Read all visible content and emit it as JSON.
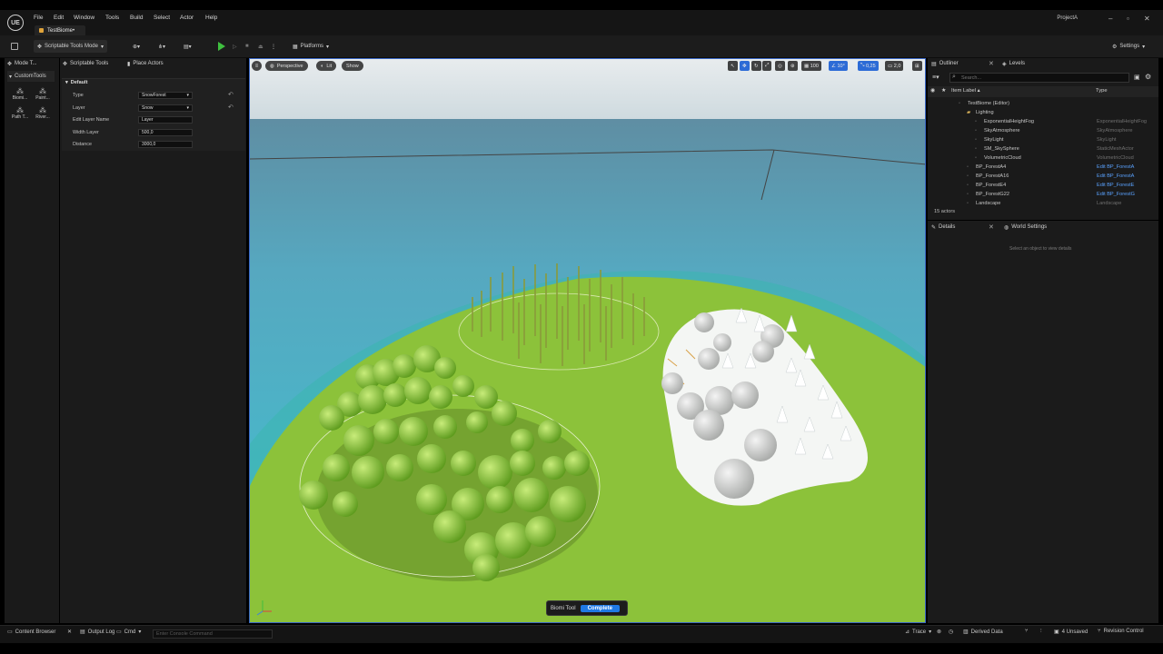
{
  "app": {
    "logo_text": "UE",
    "project": "ProjectA",
    "document_tab": "TestBiome•"
  },
  "menu": [
    "File",
    "Edit",
    "Window",
    "Tools",
    "Build",
    "Select",
    "Actor",
    "Help"
  ],
  "toolbar": {
    "mode": "Scriptable Tools Mode",
    "platforms": "Platforms",
    "settings": "Settings"
  },
  "left_tabs": {
    "mode_tab": "Mode T...",
    "scriptable_tools": "Scriptable Tools",
    "place_actors": "Place Actors"
  },
  "custom_tools": {
    "header": "CustomTools",
    "tools": [
      "Biomi...",
      "Paint...",
      "Path T...",
      "River..."
    ]
  },
  "details": {
    "section": "Default",
    "props": [
      {
        "label": "Type",
        "value": "SnowForest",
        "dropdown": true
      },
      {
        "label": "Layer",
        "value": "Snow",
        "dropdown": true
      },
      {
        "label": "Edit Layer Name",
        "value": "Layer",
        "dropdown": false
      },
      {
        "label": "Width Layer",
        "value": "500,0",
        "dropdown": false
      },
      {
        "label": "Distance",
        "value": "3000,0",
        "dropdown": false
      }
    ]
  },
  "viewport": {
    "perspective": "Perspective",
    "lit": "Lit",
    "show": "Show",
    "grid_snap": "100",
    "rot_snap": "10°",
    "scale_snap": "0,25",
    "cam_speed": "2,0",
    "biome_tool_label": "Biomi Tool",
    "complete_button": "Complete"
  },
  "outliner": {
    "tab": "Outliner",
    "levels_tab": "Levels",
    "search_placeholder": "Search...",
    "col_label": "Item Label ▴",
    "col_type": "Type",
    "rows": [
      {
        "name": "TestBiome (Editor)",
        "type": "",
        "indent": 0,
        "link": false
      },
      {
        "name": "Lighting",
        "type": "",
        "indent": 1,
        "link": false
      },
      {
        "name": "ExponentialHeightFog",
        "type": "ExponentialHeightFog",
        "indent": 2,
        "link": false
      },
      {
        "name": "SkyAtmosphere",
        "type": "SkyAtmosphere",
        "indent": 2,
        "link": false
      },
      {
        "name": "SkyLight",
        "type": "SkyLight",
        "indent": 2,
        "link": false
      },
      {
        "name": "SM_SkySphere",
        "type": "StaticMeshActor",
        "indent": 2,
        "link": false
      },
      {
        "name": "VolumetricCloud",
        "type": "VolumetricCloud",
        "indent": 2,
        "link": false
      },
      {
        "name": "BP_ForestA4",
        "type": "Edit BP_ForestA",
        "indent": 1,
        "link": true
      },
      {
        "name": "BP_ForestA16",
        "type": "Edit BP_ForestA",
        "indent": 1,
        "link": true
      },
      {
        "name": "BP_ForestE4",
        "type": "Edit BP_ForestE",
        "indent": 1,
        "link": true
      },
      {
        "name": "BP_ForestG22",
        "type": "Edit BP_ForestG",
        "indent": 1,
        "link": true
      },
      {
        "name": "Landscape",
        "type": "Landscape",
        "indent": 1,
        "link": false
      }
    ],
    "actor_count": "15 actors"
  },
  "details_panel": {
    "tab": "Details",
    "world_settings_tab": "World Settings",
    "empty_hint": "Select an object to view details"
  },
  "statusbar": {
    "content_browser": "Content Browser",
    "output_log": "Output Log",
    "cmd": "Cmd",
    "cmd_placeholder": "Enter Console Command",
    "trace": "Trace",
    "derived_data": "Derived Data",
    "unsaved": "4 Unsaved",
    "revision_control": "Revision Control"
  },
  "colors": {
    "accent": "#1f79e5",
    "link": "#5aa2ff",
    "grass": "#8fc43a",
    "water": "#43b0c8"
  }
}
